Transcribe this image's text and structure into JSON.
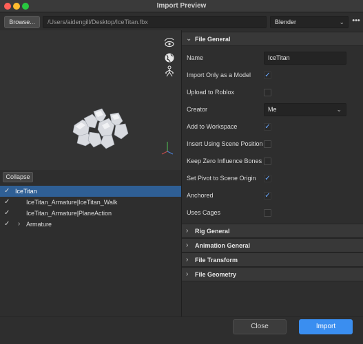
{
  "window": {
    "title": "Import Preview"
  },
  "pathbar": {
    "browse_label": "Browse...",
    "path": "/Users/aidengill/Desktop/IceTitan.fbx",
    "preset": "Blender",
    "more_label": "•••"
  },
  "viewport": {
    "tools": [
      "eye-orbit-icon",
      "globe-icon",
      "rig-icon"
    ]
  },
  "tree": {
    "collapse_label": "Collapse",
    "items": [
      {
        "label": "IceTitan",
        "checked": true,
        "selected": true
      },
      {
        "label": "IceTitan_Armature|IceTitan_Walk",
        "checked": true
      },
      {
        "label": "IceTitan_Armature|PlaneAction",
        "checked": true
      },
      {
        "label": "Armature",
        "checked": true,
        "expandable": true
      }
    ]
  },
  "properties": {
    "file_general": {
      "header": "File General",
      "rows": [
        {
          "label": "Name",
          "type": "text",
          "value": "IceTitan"
        },
        {
          "label": "Import Only as a Model",
          "type": "checkbox",
          "checked": true
        },
        {
          "label": "Upload to Roblox",
          "type": "checkbox",
          "checked": false
        },
        {
          "label": "Creator",
          "type": "select",
          "value": "Me"
        },
        {
          "label": "Add to Workspace",
          "type": "checkbox",
          "checked": true
        },
        {
          "label": "Insert Using Scene Position",
          "type": "checkbox",
          "checked": false
        },
        {
          "label": "Keep Zero Influence Bones",
          "type": "checkbox",
          "checked": false
        },
        {
          "label": "Set Pivot to Scene Origin",
          "type": "checkbox",
          "checked": true
        },
        {
          "label": "Anchored",
          "type": "checkbox",
          "checked": true
        },
        {
          "label": "Uses Cages",
          "type": "checkbox",
          "checked": false
        }
      ]
    },
    "collapsed_sections": [
      "Rig General",
      "Animation General",
      "File Transform",
      "File Geometry"
    ]
  },
  "footer": {
    "close_label": "Close",
    "import_label": "Import"
  },
  "colors": {
    "accent": "#3a8ef0",
    "selection": "#2f5f95",
    "check": "#6aa8ff"
  }
}
